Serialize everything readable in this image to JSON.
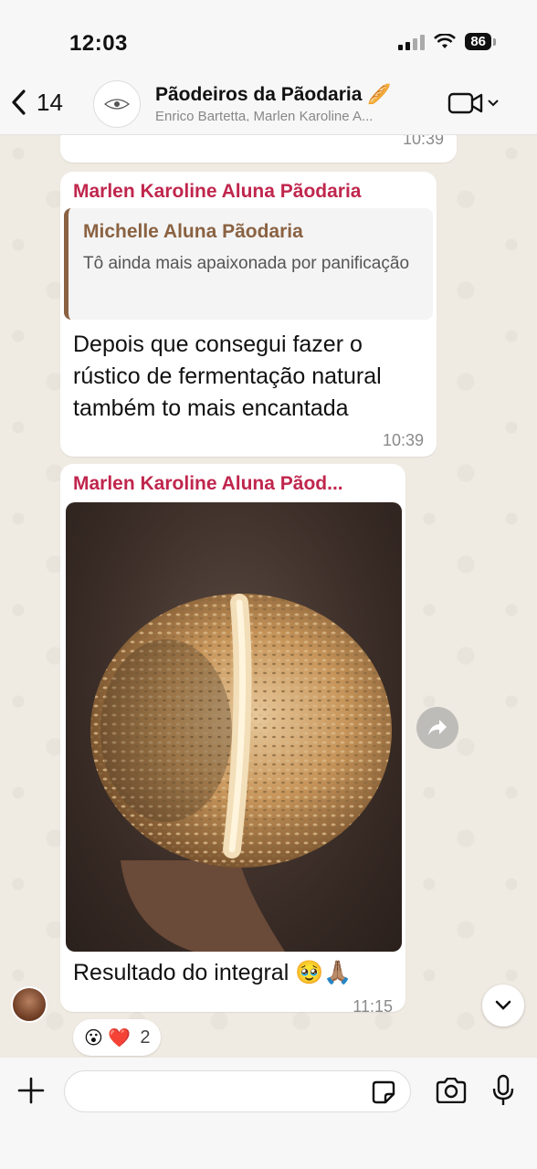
{
  "status": {
    "time": "12:03",
    "battery": "86"
  },
  "header": {
    "back_count": "14",
    "group_name": "Pãodeiros da Pãodaria 🥖",
    "members": "Enrico Bartetta, Marlen Karoline A..."
  },
  "messages": [
    {
      "time": "10:39"
    },
    {
      "sender": "Marlen Karoline Aluna Pãodaria",
      "quote_sender": "Michelle Aluna Pãodaria",
      "quote_text": "Tô ainda mais apaixonada por panificação",
      "text": "Depois que consegui fazer o rústico de fermentação natural também to mais encantada",
      "time": "10:39"
    },
    {
      "sender": "Marlen Karoline Aluna Pãod...",
      "caption": "Resultado do integral 🥹🙏🏽",
      "time": "11:15",
      "reactions": {
        "emojis": "😮 ❤️",
        "count": "2"
      }
    }
  ],
  "icons": [
    "back-chevron-icon",
    "video-call-icon",
    "forward-icon",
    "chevron-down-icon",
    "plus-icon",
    "sticker-icon",
    "camera-icon",
    "microphone-icon"
  ]
}
